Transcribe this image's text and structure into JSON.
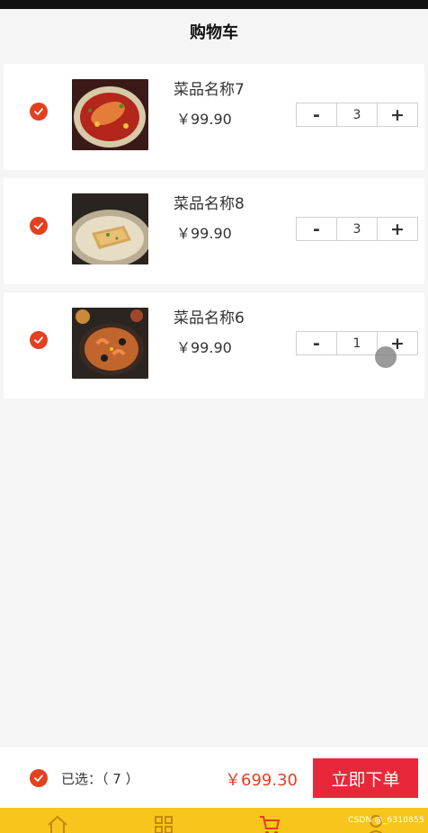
{
  "header": {
    "title": "购物车"
  },
  "items": [
    {
      "name": "菜品名称7",
      "price": "￥99.90",
      "qty": "3",
      "minus": "-",
      "plus": "+",
      "checked": true,
      "image": "spicy-fish-dish"
    },
    {
      "name": "菜品名称8",
      "price": "￥99.90",
      "qty": "3",
      "minus": "-",
      "plus": "+",
      "checked": true,
      "image": "fried-fish-dish"
    },
    {
      "name": "菜品名称6",
      "price": "￥99.90",
      "qty": "1",
      "minus": "-",
      "plus": "+",
      "checked": true,
      "image": "seafood-paella-dish"
    }
  ],
  "footer": {
    "selected_label": "已选：（ 7 ）",
    "total": "￥699.30",
    "order_button": "立即下单"
  },
  "tabbar": {
    "icons": [
      "home-icon",
      "category-icon",
      "cart-icon",
      "profile-icon"
    ],
    "watermark": "CSDN @_6310855"
  },
  "colors": {
    "accent": "#e2401f",
    "order_button": "#e8283a",
    "tabbar": "#f8c51c",
    "background": "#f5f5f5"
  }
}
